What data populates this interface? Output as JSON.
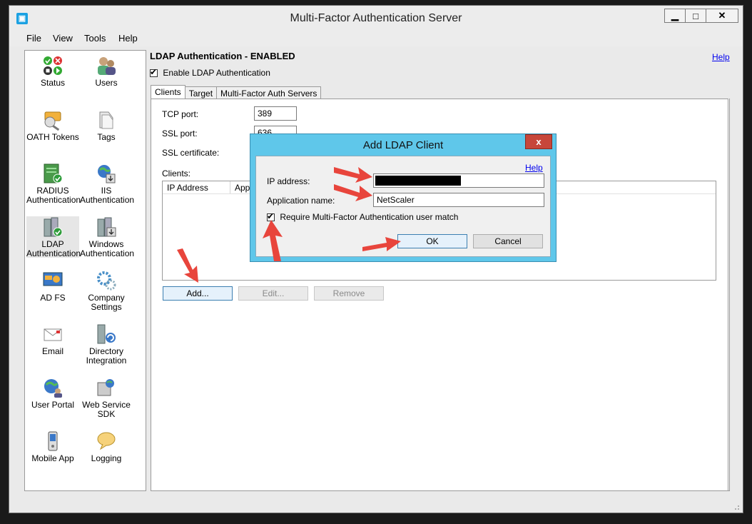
{
  "window": {
    "title": "Multi-Factor Authentication Server"
  },
  "menu": [
    "File",
    "View",
    "Tools",
    "Help"
  ],
  "sidebar": {
    "items": [
      {
        "label": "Status",
        "icon": "status-icon"
      },
      {
        "label": "Users",
        "icon": "users-icon"
      },
      {
        "label": "OATH Tokens",
        "icon": "key-icon"
      },
      {
        "label": "Tags",
        "icon": "tags-icon"
      },
      {
        "label": "RADIUS Authentication",
        "icon": "radius-icon"
      },
      {
        "label": "IIS Authentication",
        "icon": "iis-icon"
      },
      {
        "label": "LDAP Authentication",
        "icon": "ldap-icon"
      },
      {
        "label": "Windows Authentication",
        "icon": "windows-icon"
      },
      {
        "label": "AD FS",
        "icon": "adfs-icon"
      },
      {
        "label": "Company Settings",
        "icon": "settings-icon"
      },
      {
        "label": "Email",
        "icon": "email-icon"
      },
      {
        "label": "Directory Integration",
        "icon": "directory-icon"
      },
      {
        "label": "User Portal",
        "icon": "globe-icon"
      },
      {
        "label": "Web Service SDK",
        "icon": "sdk-icon"
      },
      {
        "label": "Mobile App",
        "icon": "phone-icon"
      },
      {
        "label": "Logging",
        "icon": "speech-icon"
      }
    ]
  },
  "main": {
    "heading": "LDAP Authentication - ENABLED",
    "help": "Help",
    "enable_label": "Enable LDAP Authentication",
    "tabs": [
      "Clients",
      "Target",
      "Multi-Factor Auth Servers"
    ],
    "tcp_label": "TCP port:",
    "tcp_value": "389",
    "ssl_label": "SSL port:",
    "ssl_value": "636",
    "cert_label": "SSL certificate:",
    "clients_label": "Clients:",
    "columns": [
      "IP Address",
      "Appl"
    ],
    "add_button": "Add...",
    "edit_button": "Edit...",
    "remove_button": "Remove"
  },
  "dialog": {
    "title": "Add LDAP Client",
    "close": "x",
    "help": "Help",
    "ip_label": "IP address:",
    "app_label": "Application name:",
    "app_value": "NetScaler",
    "require_label": "Require Multi-Factor Authentication user match",
    "ok": "OK",
    "cancel": "Cancel"
  },
  "colors": {
    "dialog_frame": "#5fc7ea",
    "arrow": "#e8453c",
    "close": "#c7463a"
  }
}
